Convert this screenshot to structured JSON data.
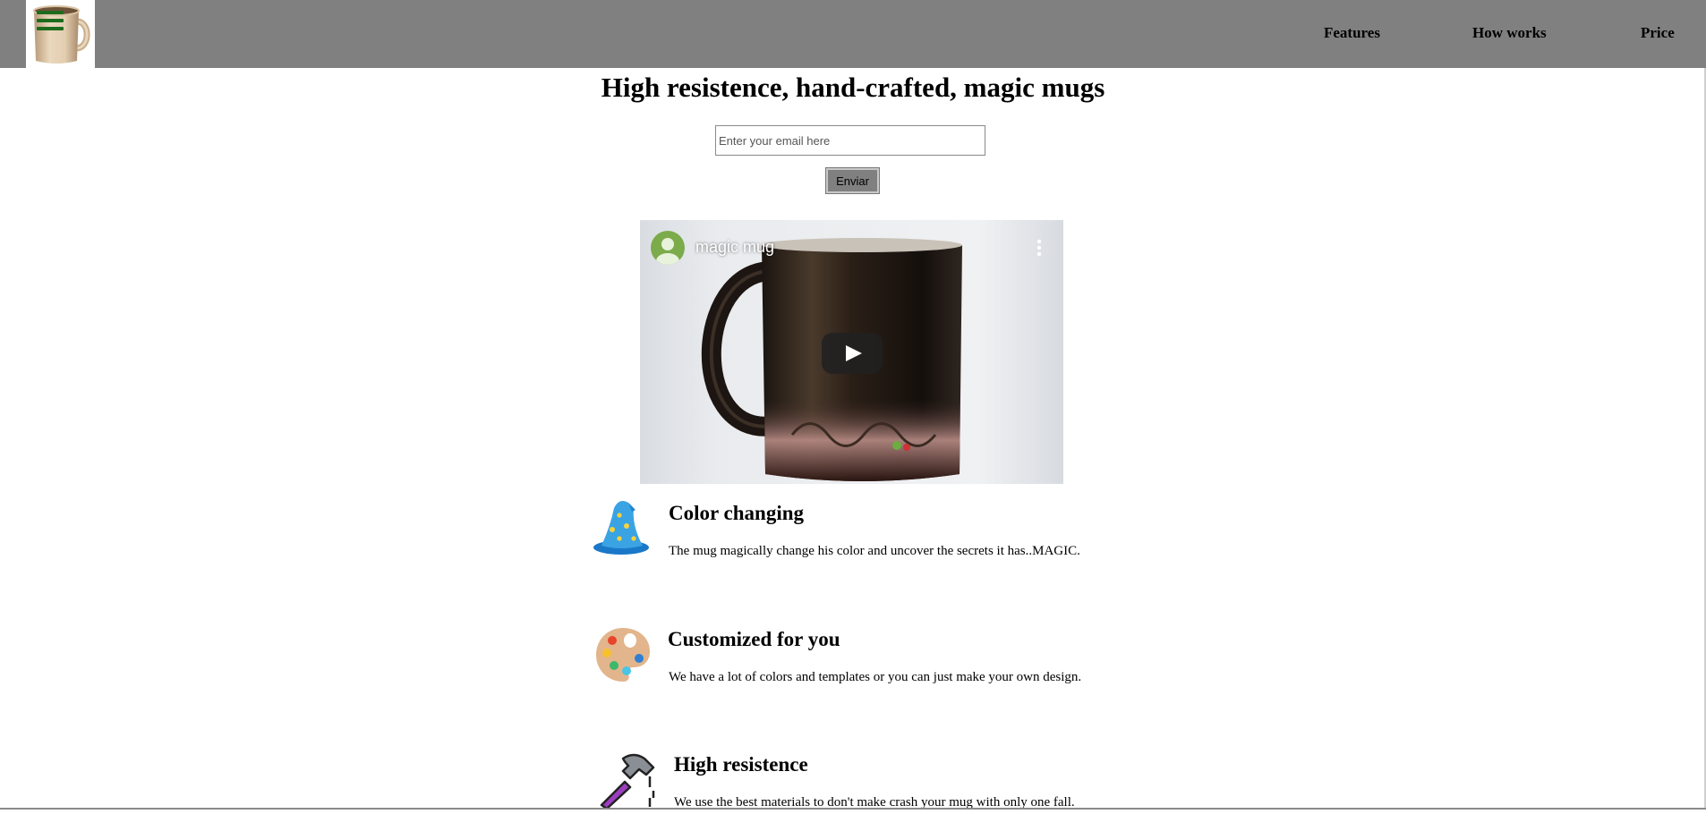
{
  "header": {
    "nav": [
      {
        "label": "Features"
      },
      {
        "label": "How works"
      },
      {
        "label": "Price"
      }
    ]
  },
  "hero": {
    "title": "High resistence, hand-crafted, magic mugs",
    "email_placeholder": "Enter your email here",
    "email_value": "",
    "submit_label": "Enviar"
  },
  "video": {
    "title": "magic mug"
  },
  "features": [
    {
      "icon": "wizard-hat-icon",
      "title": "Color changing",
      "text": "The mug magically change his color and uncover the secrets it has..MAGIC."
    },
    {
      "icon": "palette-icon",
      "title": "Customized for you",
      "text": "We have a lot of colors and templates or you can just make your own design."
    },
    {
      "icon": "hammer-icon",
      "title": "High resistence",
      "text": "We use the best materials to don't make crash your mug with only one fall."
    }
  ],
  "colors": {
    "header_bg": "#808080",
    "hamburger": "#1d6b1d",
    "button_bg": "#808080"
  }
}
